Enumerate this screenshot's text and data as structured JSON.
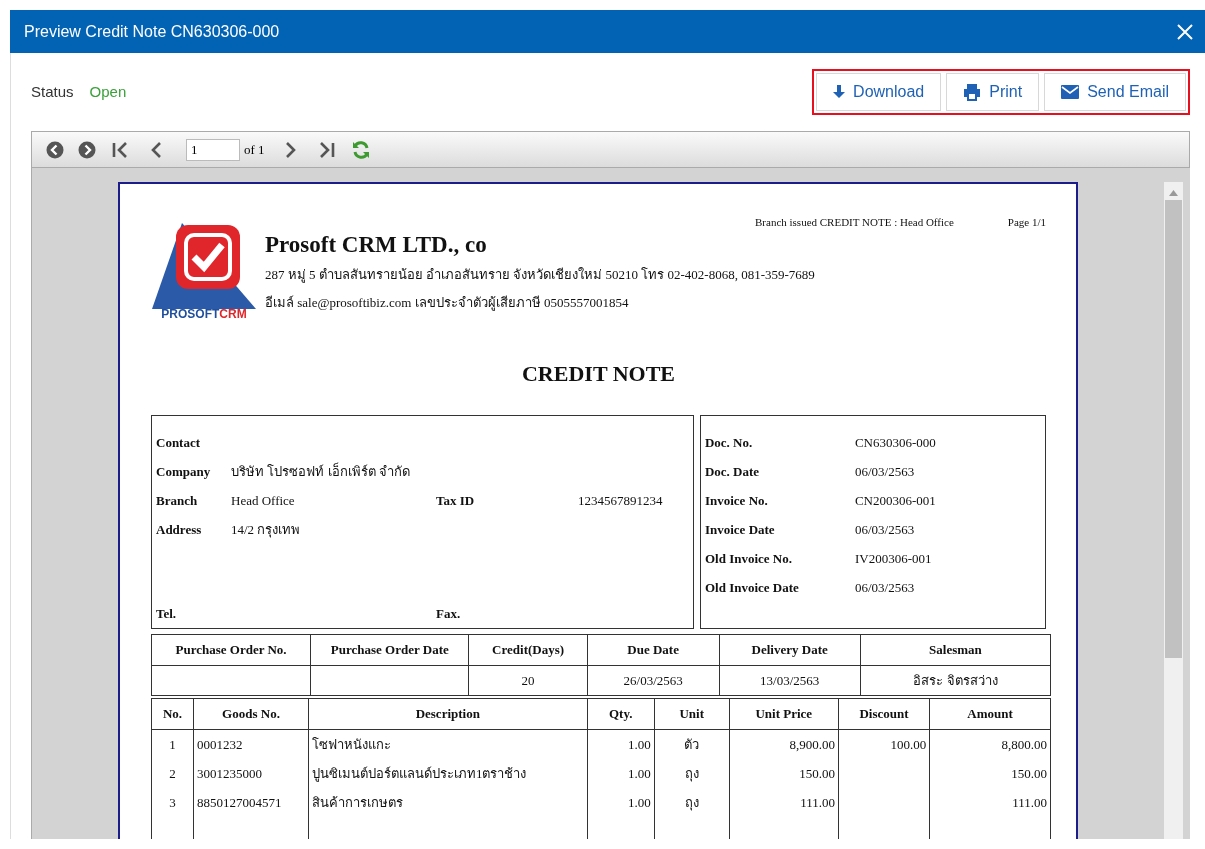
{
  "dialog": {
    "title": "Preview Credit Note CN630306-000"
  },
  "status": {
    "label": "Status",
    "value": "Open"
  },
  "actions": [
    {
      "kind": "download",
      "label": "Download"
    },
    {
      "kind": "print",
      "label": "Print"
    },
    {
      "kind": "email",
      "label": "Send Email"
    }
  ],
  "toolbar": {
    "page_value": "1",
    "page_count": "of 1"
  },
  "document": {
    "branch_note": "Branch issued CREDIT NOTE : Head Office",
    "page": "Page 1/1",
    "logo": {
      "text_1": "PROSOFT",
      "text_2": "CRM"
    },
    "company": "Prosoft CRM LTD., co",
    "address": "287 หมู่ 5 ตำบลสันทรายน้อย อำเภอสันทราย จังหวัดเชียงใหม่ 50210 โทร 02-402-8068, 081-359-7689",
    "email_line": "อีเมล์ sale@prosoftibiz.com เลขประจำตัวผู้เสียภาษี 0505557001854",
    "title": "CREDIT NOTE",
    "contact_rows": [
      {
        "label": "Contact"
      },
      {
        "label": "Company",
        "value": "บริษัท โปรซอฟท์ เอ็กเพิร์ต จำกัด"
      },
      {
        "label": "Branch",
        "value": "Head Office",
        "label_2": "Tax ID",
        "value_2": "1234567891234"
      },
      {
        "label": "Address",
        "value": "14/2 กรุงเทพ"
      }
    ],
    "contact_footer": {
      "label": "Tel.",
      "label_2": "Fax."
    },
    "doc_rows": [
      {
        "label": "Doc. No.",
        "value": "CN630306-000"
      },
      {
        "label": "Doc. Date",
        "value": "06/03/2563"
      },
      {
        "label": "Invoice No.",
        "value": "CN200306-001"
      },
      {
        "label": "Invoice Date",
        "value": "06/03/2563"
      },
      {
        "label": "Old Invoice No.",
        "value": "IV200306-001"
      },
      {
        "label": "Old Invoice Date",
        "value": "06/03/2563"
      }
    ],
    "order_table": {
      "columns": [
        "Purchase Order No.",
        "Purchase Order Date",
        "Credit(Days)",
        "Due Date",
        "Delivery Date",
        "Salesman"
      ],
      "row": {
        "credit_days": "20",
        "due_date": "26/03/2563",
        "delivery_date": "13/03/2563",
        "salesman": "อิสระ จิตรสว่าง"
      }
    },
    "items_table": {
      "columns": [
        "No.",
        "Goods No.",
        "Description",
        "Qty.",
        "Unit",
        "Unit Price",
        "Discount",
        "Amount"
      ],
      "rows": [
        [
          "1",
          "0001232",
          "โซฟาหนังแกะ",
          "1.00",
          "ตัว",
          "8,900.00",
          "100.00",
          "8,800.00"
        ],
        [
          "2",
          "3001235000",
          "ปูนซิเมนต์ปอร์ตแลนด์ประเภท1ตราช้าง",
          "1.00",
          "ถุง",
          "150.00",
          "",
          "150.00"
        ],
        [
          "3",
          "8850127004571",
          "สินค้าการเกษตร",
          "1.00",
          "ถุง",
          "111.00",
          "",
          "111.00"
        ]
      ]
    }
  }
}
